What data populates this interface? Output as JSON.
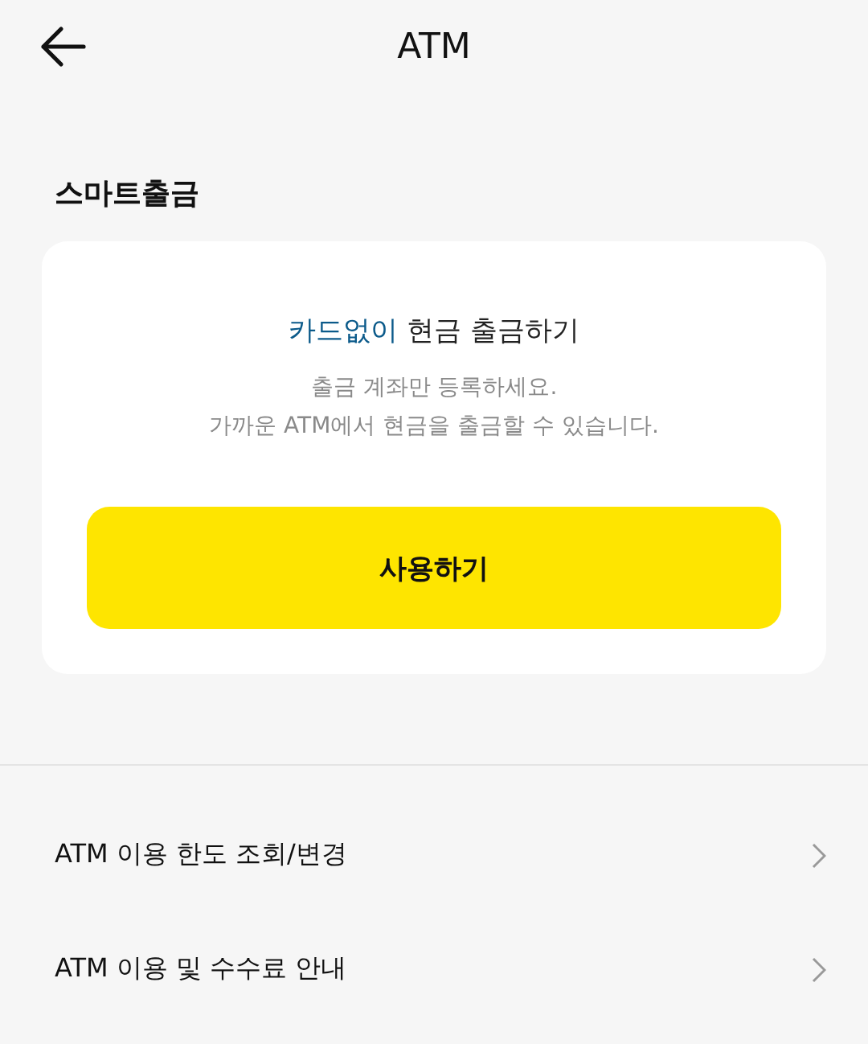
{
  "header": {
    "title": "ATM"
  },
  "section": {
    "title": "스마트출금"
  },
  "card": {
    "heading_highlight": "카드없이",
    "heading_rest": "현금 출금하기",
    "description_lines": [
      "출금 계좌만 등록하세요.",
      "가까운 ATM에서 현금을 출금할 수 있습니다."
    ],
    "button": "사용하기"
  },
  "menu": [
    {
      "label": "ATM 이용 한도 조회/변경"
    },
    {
      "label": "ATM 이용 및 수수료 안내"
    }
  ]
}
